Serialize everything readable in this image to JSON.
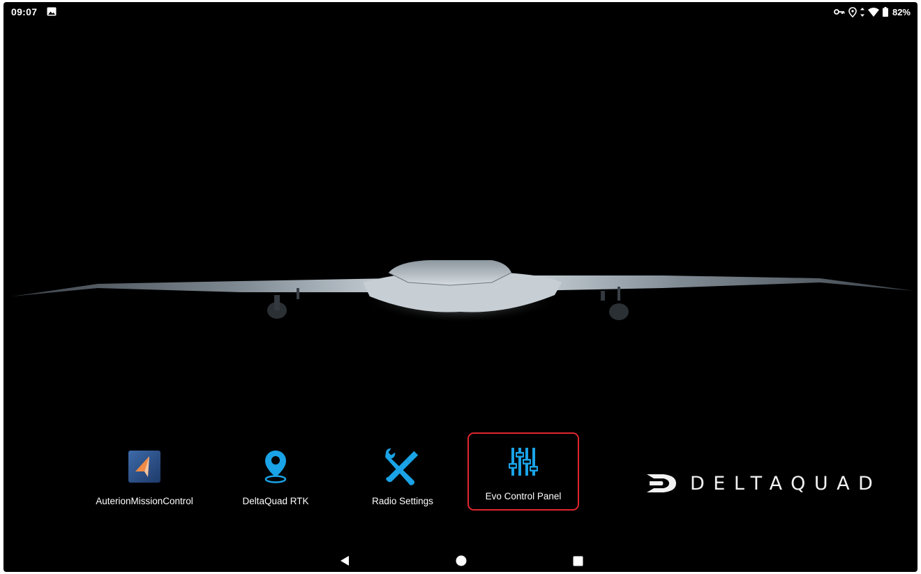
{
  "status_bar": {
    "time": "09:07",
    "battery_percent": "82%",
    "icons": [
      "gallery-icon",
      "vpn-key-icon",
      "location-icon",
      "data-arrows-icon",
      "wifi-icon",
      "battery-icon"
    ]
  },
  "apps": [
    {
      "label": "AuterionMissionControl",
      "icon": "auterion-mission-control-icon"
    },
    {
      "label": "DeltaQuad RTK",
      "icon": "location-pin-icon"
    },
    {
      "label": "Radio Settings",
      "icon": "wrench-screwdriver-icon"
    },
    {
      "label": "Evo Control Panel",
      "icon": "sliders-icon",
      "selected": true
    }
  ],
  "brand": {
    "text": "DELTAQUAD"
  },
  "nav_bar": {
    "buttons": [
      "back",
      "home",
      "recents"
    ]
  },
  "colors": {
    "background": "#000000",
    "accent_blue": "#1aa3e6",
    "selection_red": "#e0262d",
    "auterion_orange": "#f08a45",
    "auterion_bg": "#2a4d86"
  }
}
